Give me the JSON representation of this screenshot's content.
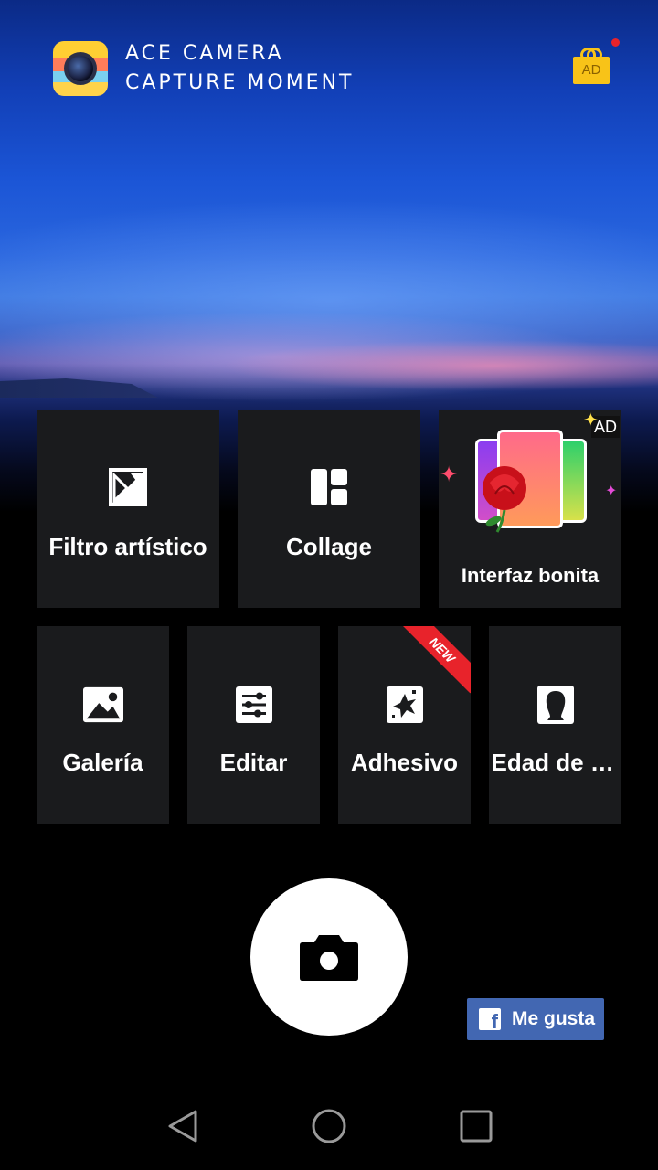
{
  "app": {
    "name_line1": "ACE CAMERA",
    "name_line2": "CAPTURE MOMENT",
    "logo_icon": "camera-lens-icon"
  },
  "header": {
    "gift_ad_label": "AD",
    "gift_icon": "gift-icon",
    "notification_dot_color": "#e8232b"
  },
  "tiles_row1": [
    {
      "label": "Filtro artístico",
      "icon": "art-filter-icon"
    },
    {
      "label": "Collage",
      "icon": "collage-layout-icon"
    },
    {
      "label": "Interfaz bonita",
      "icon": "themes-phones-rose-icon",
      "badge": "AD"
    }
  ],
  "tiles_row2": [
    {
      "label": "Galería",
      "icon": "image-gallery-icon"
    },
    {
      "label": "Editar",
      "icon": "sliders-edit-icon"
    },
    {
      "label": "Adhesivo",
      "icon": "sticker-icon",
      "ribbon": "NEW"
    },
    {
      "label": "Edad de la cara",
      "icon": "face-silhouette-icon"
    }
  ],
  "shutter": {
    "icon": "camera-icon"
  },
  "facebook": {
    "label": "Me gusta",
    "color": "#4267b2"
  },
  "navigation": {
    "back": "back-triangle-icon",
    "home": "home-circle-icon",
    "recents": "recents-square-icon"
  },
  "colors": {
    "tile_bg": "#1a1b1d",
    "ribbon": "#e8232b",
    "gift": "#f8c318"
  }
}
